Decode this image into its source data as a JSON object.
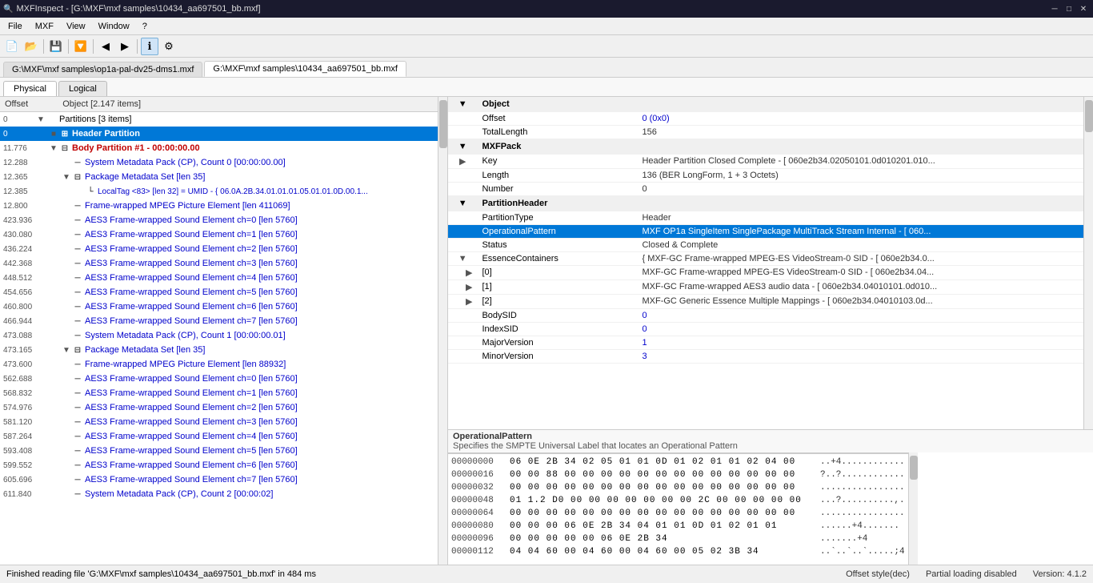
{
  "titleBar": {
    "title": "MXFInspect - [G:\\MXF\\mxf samples\\10434_aa697501_bb.mxf]",
    "icon": "🔍",
    "minimize": "─",
    "maximize": "□",
    "close": "✕",
    "minBtn": "─",
    "maxBtn": "□",
    "closeBtn": "✕"
  },
  "menuBar": {
    "items": [
      "File",
      "MXF",
      "View",
      "Window",
      "?"
    ]
  },
  "toolbar": {
    "buttons": [
      {
        "name": "new-btn",
        "icon": "📄",
        "label": "New"
      },
      {
        "name": "open-btn",
        "icon": "📂",
        "label": "Open"
      },
      {
        "name": "save-btn",
        "icon": "💾",
        "label": "Save"
      },
      {
        "name": "filter-btn",
        "icon": "🔽",
        "label": "Filter"
      },
      {
        "name": "back-btn",
        "icon": "◀",
        "label": "Back"
      },
      {
        "name": "forward-btn",
        "icon": "▶",
        "label": "Forward"
      },
      {
        "name": "info-btn",
        "icon": "ℹ",
        "label": "Info",
        "active": true
      },
      {
        "name": "settings-btn",
        "icon": "⚙",
        "label": "Settings"
      }
    ]
  },
  "tabs": [
    {
      "id": "tab1",
      "label": "G:\\MXF\\mxf samples\\op1a-pal-dv25-dms1.mxf"
    },
    {
      "id": "tab2",
      "label": "G:\\MXF\\mxf samples\\10434_aa697501_bb.mxf",
      "active": true
    }
  ],
  "viewTabs": [
    {
      "id": "physical",
      "label": "Physical",
      "active": true
    },
    {
      "id": "logical",
      "label": "Logical"
    }
  ],
  "tree": {
    "header": "Object [2.147 items]",
    "rows": [
      {
        "id": "r0",
        "indent": 0,
        "expander": "▼",
        "icon": "",
        "text": "Partitions [3 items]",
        "offset": "0",
        "style": "normal"
      },
      {
        "id": "r1",
        "indent": 1,
        "expander": "■",
        "icon": "⊞",
        "text": "Header Partition",
        "offset": "0",
        "style": "selected"
      },
      {
        "id": "r2",
        "indent": 1,
        "expander": "▼",
        "icon": "⊟",
        "text": "Body Partition #1 - 00:00:00.00",
        "offset": "11.776",
        "style": "body"
      },
      {
        "id": "r3",
        "indent": 2,
        "expander": "",
        "icon": "─",
        "text": "System Metadata Pack (CP), Count 0 [00:00:00.00]",
        "offset": "12.288",
        "style": "blue"
      },
      {
        "id": "r4",
        "indent": 2,
        "expander": "▼",
        "icon": "⊟",
        "text": "Package Metadata Set [len 35]",
        "offset": "12.365",
        "style": "blue"
      },
      {
        "id": "r5",
        "indent": 3,
        "expander": "",
        "icon": "└",
        "text": "LocalTag <83> [len 32] = UMID - { 06.0A.2B.34.01.01.01.05.01.01.0D.00.1...",
        "offset": "12.385",
        "style": "blue"
      },
      {
        "id": "r6",
        "indent": 2,
        "expander": "",
        "icon": "─",
        "text": "Frame-wrapped MPEG Picture Element [len 411069]",
        "offset": "12.800",
        "style": "blue"
      },
      {
        "id": "r7",
        "indent": 2,
        "expander": "",
        "icon": "─",
        "text": "AES3 Frame-wrapped Sound Element ch=0 [len 5760]",
        "offset": "423.936",
        "style": "blue"
      },
      {
        "id": "r8",
        "indent": 2,
        "expander": "",
        "icon": "─",
        "text": "AES3 Frame-wrapped Sound Element ch=1 [len 5760]",
        "offset": "430.080",
        "style": "blue"
      },
      {
        "id": "r9",
        "indent": 2,
        "expander": "",
        "icon": "─",
        "text": "AES3 Frame-wrapped Sound Element ch=2 [len 5760]",
        "offset": "436.224",
        "style": "blue"
      },
      {
        "id": "r10",
        "indent": 2,
        "expander": "",
        "icon": "─",
        "text": "AES3 Frame-wrapped Sound Element ch=3 [len 5760]",
        "offset": "442.368",
        "style": "blue"
      },
      {
        "id": "r11",
        "indent": 2,
        "expander": "",
        "icon": "─",
        "text": "AES3 Frame-wrapped Sound Element ch=4 [len 5760]",
        "offset": "448.512",
        "style": "blue"
      },
      {
        "id": "r12",
        "indent": 2,
        "expander": "",
        "icon": "─",
        "text": "AES3 Frame-wrapped Sound Element ch=5 [len 5760]",
        "offset": "454.656",
        "style": "blue"
      },
      {
        "id": "r13",
        "indent": 2,
        "expander": "",
        "icon": "─",
        "text": "AES3 Frame-wrapped Sound Element ch=6 [len 5760]",
        "offset": "460.800",
        "style": "blue"
      },
      {
        "id": "r14",
        "indent": 2,
        "expander": "",
        "icon": "─",
        "text": "AES3 Frame-wrapped Sound Element ch=7 [len 5760]",
        "offset": "466.944",
        "style": "blue"
      },
      {
        "id": "r15",
        "indent": 2,
        "expander": "",
        "icon": "─",
        "text": "System Metadata Pack (CP), Count 1 [00:00:00.01]",
        "offset": "473.088",
        "style": "blue"
      },
      {
        "id": "r16",
        "indent": 2,
        "expander": "▼",
        "icon": "⊟",
        "text": "Package Metadata Set [len 35]",
        "offset": "473.165",
        "style": "blue"
      },
      {
        "id": "r17",
        "indent": 2,
        "expander": "",
        "icon": "─",
        "text": "Frame-wrapped MPEG Picture Element [len 88932]",
        "offset": "473.600",
        "style": "blue"
      },
      {
        "id": "r18",
        "indent": 2,
        "expander": "",
        "icon": "─",
        "text": "AES3 Frame-wrapped Sound Element ch=0 [len 5760]",
        "offset": "562.688",
        "style": "blue"
      },
      {
        "id": "r19",
        "indent": 2,
        "expander": "",
        "icon": "─",
        "text": "AES3 Frame-wrapped Sound Element ch=1 [len 5760]",
        "offset": "568.832",
        "style": "blue"
      },
      {
        "id": "r20",
        "indent": 2,
        "expander": "",
        "icon": "─",
        "text": "AES3 Frame-wrapped Sound Element ch=2 [len 5760]",
        "offset": "574.976",
        "style": "blue"
      },
      {
        "id": "r21",
        "indent": 2,
        "expander": "",
        "icon": "─",
        "text": "AES3 Frame-wrapped Sound Element ch=3 [len 5760]",
        "offset": "581.120",
        "style": "blue"
      },
      {
        "id": "r22",
        "indent": 2,
        "expander": "",
        "icon": "─",
        "text": "AES3 Frame-wrapped Sound Element ch=4 [len 5760]",
        "offset": "587.264",
        "style": "blue"
      },
      {
        "id": "r23",
        "indent": 2,
        "expander": "",
        "icon": "─",
        "text": "AES3 Frame-wrapped Sound Element ch=5 [len 5760]",
        "offset": "593.408",
        "style": "blue"
      },
      {
        "id": "r24",
        "indent": 2,
        "expander": "",
        "icon": "─",
        "text": "AES3 Frame-wrapped Sound Element ch=6 [len 5760]",
        "offset": "599.552",
        "style": "blue"
      },
      {
        "id": "r25",
        "indent": 2,
        "expander": "",
        "icon": "─",
        "text": "AES3 Frame-wrapped Sound Element ch=7 [len 5760]",
        "offset": "605.696",
        "style": "blue"
      },
      {
        "id": "r26",
        "indent": 2,
        "expander": "",
        "icon": "─",
        "text": "System Metadata Pack (CP), Count 2 [00:00:02]",
        "offset": "611.840",
        "style": "blue"
      }
    ]
  },
  "properties": {
    "sections": [
      {
        "id": "object",
        "label": "Object",
        "expanded": true,
        "chevron": "▼",
        "rows": [
          {
            "key": "Offset",
            "value": "0 (0x0)",
            "valueStyle": "blue"
          },
          {
            "key": "TotalLength",
            "value": "156",
            "valueStyle": "normal"
          }
        ]
      },
      {
        "id": "mxfpack",
        "label": "MXFPack",
        "expanded": true,
        "chevron": "▼",
        "rows": [
          {
            "key": "Key",
            "value": "Header Partition Closed Complete - [ 060e2b34.02050101.0d010201.010...",
            "valueStyle": "normal",
            "hasChevron": true,
            "chevron": "▶"
          },
          {
            "key": "Length",
            "value": "136 (BER LongForm, 1 + 3 Octets)",
            "valueStyle": "normal"
          },
          {
            "key": "Number",
            "value": "0",
            "valueStyle": "normal"
          }
        ]
      },
      {
        "id": "partitionheader",
        "label": "PartitionHeader",
        "expanded": true,
        "chevron": "▼",
        "rows": [
          {
            "key": "PartitionType",
            "value": "Header",
            "valueStyle": "normal"
          },
          {
            "key": "OperationalPattern",
            "value": "MXF OP1a SingleItem SinglePackage MultiTrack Stream Internal - [ 060...",
            "valueStyle": "normal",
            "selected": true
          },
          {
            "key": "Status",
            "value": "Closed & Complete",
            "valueStyle": "normal"
          },
          {
            "key": "EssenceContainers",
            "value": "{ MXF-GC Frame-wrapped MPEG-ES VideoStream-0 SID - [ 060e2b34.0...",
            "valueStyle": "normal",
            "hasChevron": true,
            "chevron": "▼",
            "children": [
              {
                "key": "[0]",
                "value": "MXF-GC Frame-wrapped MPEG-ES VideoStream-0 SID - [ 060e2b34.04...",
                "hasChevron": true,
                "chevron": "▶"
              },
              {
                "key": "[1]",
                "value": "MXF-GC Frame-wrapped AES3 audio data - [ 060e2b34.04010101.0d010...",
                "hasChevron": true,
                "chevron": "▶"
              },
              {
                "key": "[2]",
                "value": "MXF-GC Generic Essence Multiple Mappings - [ 060e2b34.04010103.0d...",
                "hasChevron": true,
                "chevron": "▶"
              }
            ]
          },
          {
            "key": "BodySID",
            "value": "0",
            "valueStyle": "blue"
          },
          {
            "key": "IndexSID",
            "value": "0",
            "valueStyle": "blue"
          },
          {
            "key": "MajorVersion",
            "value": "1",
            "valueStyle": "blue"
          },
          {
            "key": "MinorVersion",
            "value": "3",
            "valueStyle": "blue"
          }
        ]
      }
    ]
  },
  "description": {
    "title": "OperationalPattern",
    "text": "Specifies the SMPTE Universal Label that locates an Operational Pattern"
  },
  "hex": {
    "rows": [
      {
        "offset": "00000000",
        "bytes": "06 0E 2B 34 02 05 01 01 0D 01 02 01 01 02 04 00",
        "ascii": "..+4............"
      },
      {
        "offset": "00000016",
        "bytes": "00 00 88 00 00 00 00 00 00 00 00 00 00 00 00 00",
        "ascii": "?..?............"
      },
      {
        "offset": "00000032",
        "bytes": "00 00 00 00 00 00 00 00 00 00 00 00 00 00 00 00",
        "ascii": "................"
      },
      {
        "offset": "00000048",
        "bytes": "01 1.2 D0 00 00 00 00 00 00 00 2C 00 00 00 00 00",
        "ascii": "...?..........,."
      },
      {
        "offset": "00000064",
        "bytes": "00 00 00 00 00 00 00 00 00 00 00 00 00 00 00 00",
        "ascii": "................"
      },
      {
        "offset": "00000080",
        "bytes": "00 00 00 06 0E 2B 34 04 01 01 0D 01 02 01 01",
        "ascii": "......+4......."
      },
      {
        "offset": "00000096",
        "bytes": "00 00 00 00 00 06 0E 2B 34",
        "ascii": ".......+4"
      },
      {
        "offset": "00000112",
        "bytes": "04 04 60 00 04 60 00 04 60 00 05 02 3B 34",
        "ascii": "..`..`..`.....;4"
      }
    ]
  },
  "statusBar": {
    "left": "Finished reading file 'G:\\MXF\\mxf samples\\10434_aa697501_bb.mxf' in 484 ms",
    "offsetStyle": "Offset style(dec)",
    "partialLoading": "Partial loading disabled",
    "version": "Version: 4.1.2"
  }
}
